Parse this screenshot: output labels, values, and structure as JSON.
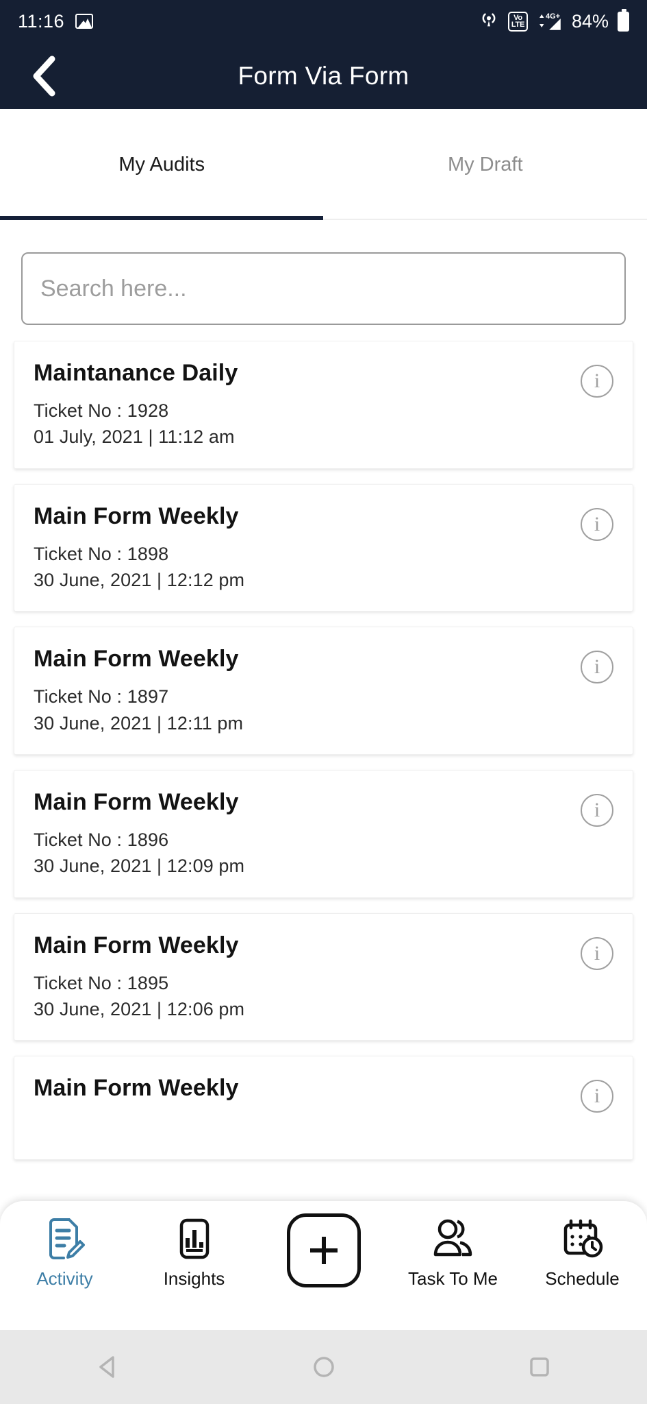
{
  "status_bar": {
    "time": "11:16",
    "battery_percent": "84%",
    "icons": [
      "photo-icon",
      "cast-icon",
      "volte-icon",
      "signal-4g-icon",
      "battery-icon"
    ],
    "volte_top": "Vo",
    "volte_bottom": "LTE",
    "network": "4G+"
  },
  "header": {
    "title": "Form Via Form",
    "back_icon": "chevron-left-icon",
    "background": "#151f33"
  },
  "tabs": [
    {
      "label": "My Audits",
      "active": true
    },
    {
      "label": "My Draft",
      "active": false
    }
  ],
  "search": {
    "placeholder": "Search here...",
    "value": ""
  },
  "list": {
    "info_glyph": "i",
    "items": [
      {
        "title": "Maintanance Daily",
        "ticket": "Ticket No : 1928",
        "datetime": "01 July, 2021 | 11:12 am"
      },
      {
        "title": "Main Form Weekly",
        "ticket": "Ticket No : 1898",
        "datetime": "30 June, 2021 | 12:12 pm"
      },
      {
        "title": "Main Form Weekly",
        "ticket": "Ticket No : 1897",
        "datetime": "30 June, 2021 | 12:11 pm"
      },
      {
        "title": "Main Form Weekly",
        "ticket": "Ticket No : 1896",
        "datetime": "30 June, 2021 | 12:09 pm"
      },
      {
        "title": "Main Form Weekly",
        "ticket": "Ticket No : 1895",
        "datetime": "30 June, 2021 | 12:06 pm"
      },
      {
        "title": "Main Form Weekly",
        "ticket": "",
        "datetime": ""
      }
    ]
  },
  "bottom_nav": {
    "accent": "#3d7ea6",
    "items": [
      {
        "label": "Activity",
        "icon": "document-pencil-icon",
        "active": true
      },
      {
        "label": "Insights",
        "icon": "bar-chart-icon",
        "active": false
      },
      {
        "label": "",
        "icon": "plus-icon",
        "active": false
      },
      {
        "label": "Task To Me",
        "icon": "people-icon",
        "active": false
      },
      {
        "label": "Schedule",
        "icon": "calendar-clock-icon",
        "active": false
      }
    ]
  },
  "android_nav": {
    "back": "back-triangle-icon",
    "home": "home-circle-icon",
    "recents": "recents-square-icon"
  }
}
